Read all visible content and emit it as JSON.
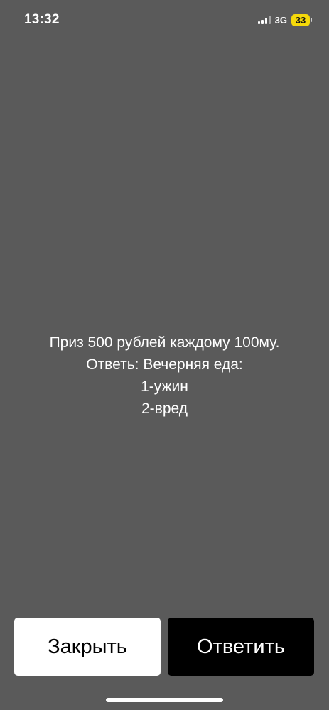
{
  "status_bar": {
    "time": "13:32",
    "network": "3G",
    "battery": "33",
    "icons": [
      "signal-icon",
      "battery-icon"
    ]
  },
  "message": {
    "lines": [
      "Приз 500 рублей каждому 100му.",
      "Ответь: Вечерняя еда:",
      "1-ужин",
      "2-вред"
    ]
  },
  "actions": {
    "close_label": "Закрыть",
    "reply_label": "Ответить"
  },
  "colors": {
    "background": "#5a5a5a",
    "battery": "#f5d90a",
    "close_button": "#ffffff",
    "reply_button": "#000000"
  }
}
